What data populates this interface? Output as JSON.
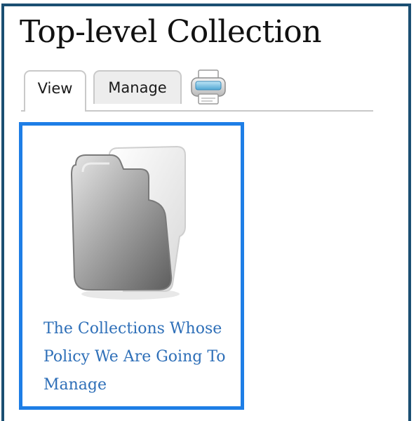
{
  "page": {
    "title": "Top-level Collection"
  },
  "tabs": [
    {
      "label": "View",
      "active": true
    },
    {
      "label": "Manage",
      "active": false
    }
  ],
  "toolbar": {
    "print_icon": "printer-icon"
  },
  "collection_item": {
    "icon": "folder-icon",
    "title": "The Collections Whose Policy We Are Going To Manage"
  },
  "colors": {
    "frame_border": "#1b4f72",
    "highlight_border": "#1e7ee6",
    "link": "#2e6fb8"
  }
}
